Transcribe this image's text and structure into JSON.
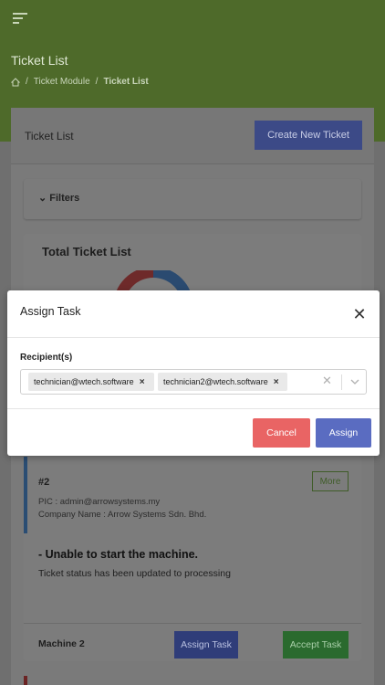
{
  "header": {
    "page_title": "Ticket List",
    "breadcrumb": [
      "Ticket Module",
      "Ticket List"
    ],
    "colors": {
      "bar": "#7b9c4a"
    }
  },
  "card": {
    "title": "Ticket List",
    "create_button": "Create New Ticket",
    "filters_label": "Filters",
    "total_title": "Total Ticket List"
  },
  "ticket": {
    "number": "#2",
    "more_button": "More",
    "pic": "PIC : admin@arrowsystems.my",
    "company": "Company Name : Arrow Systems Sdn. Bhd.",
    "issue": "- Unable to start the machine.",
    "status_text": "Ticket status has been updated to processing",
    "machine": "Machine 2",
    "assign_task_button": "Assign Task",
    "accept_task_button": "Accept Task"
  },
  "modal": {
    "title": "Assign Task",
    "close_icon": "close-icon",
    "field_label": "Recipient(s)",
    "recipients": [
      "technician@wtech.software",
      "technician2@wtech.software"
    ],
    "cancel_button": "Cancel",
    "assign_button": "Assign",
    "colors": {
      "cancel": "#e96464",
      "assign": "#5a6cc1"
    }
  }
}
